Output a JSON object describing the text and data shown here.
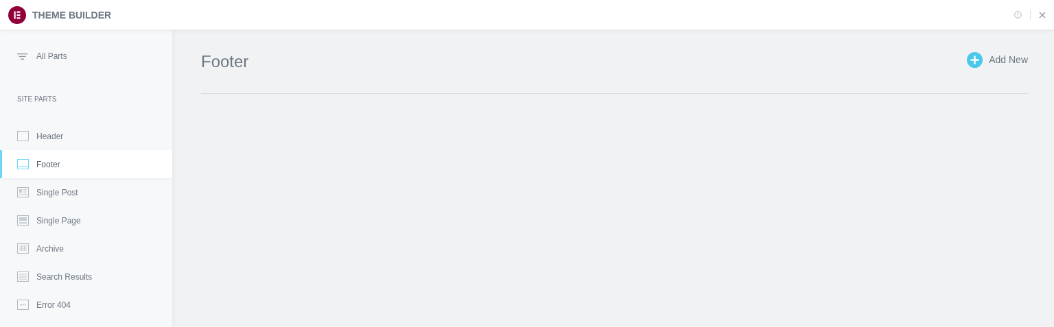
{
  "app": {
    "title": "THEME BUILDER"
  },
  "sidebar": {
    "all_parts": "All Parts",
    "section_title": "SITE PARTS",
    "items": [
      {
        "label": "Header",
        "kind": "header",
        "selected": false
      },
      {
        "label": "Footer",
        "kind": "footer",
        "selected": true
      },
      {
        "label": "Single Post",
        "kind": "single-post",
        "selected": false
      },
      {
        "label": "Single Page",
        "kind": "single-page",
        "selected": false
      },
      {
        "label": "Archive",
        "kind": "archive",
        "selected": false
      },
      {
        "label": "Search Results",
        "kind": "search-results",
        "selected": false
      },
      {
        "label": "Error 404",
        "kind": "error-404",
        "selected": false
      }
    ]
  },
  "main": {
    "title": "Footer",
    "add_button": "Add New"
  }
}
